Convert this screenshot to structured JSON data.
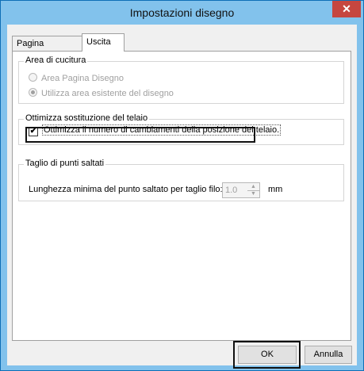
{
  "window": {
    "title": "Impostazioni disegno",
    "close_glyph": "✕"
  },
  "tabs": [
    {
      "label": "Pagina Disegno",
      "active": false
    },
    {
      "label": "Uscita",
      "active": true
    }
  ],
  "sewing_area": {
    "label": "Area di cucitura",
    "options": [
      {
        "label": "Area Pagina Disegno",
        "selected": false,
        "enabled": false
      },
      {
        "label": "Utilizza area esistente del disegno",
        "selected": true,
        "enabled": false
      }
    ]
  },
  "hoop_optimize": {
    "label": "Ottimizza sostituzione del telaio",
    "checkbox_label": "Ottimizza il numero di cambiamenti della posizione del telaio.",
    "checked": true,
    "check_glyph": "✔"
  },
  "jump_trim": {
    "label": "Taglio di punti saltati",
    "field_label": "Lunghezza minima del punto saltato per taglio filo:",
    "value": "1.0",
    "unit": "mm",
    "up_glyph": "▲",
    "down_glyph": "▼"
  },
  "buttons": {
    "ok": "OK",
    "cancel": "Annulla"
  },
  "colors": {
    "titlebar": "#82c2ec",
    "close": "#c6463f",
    "window_bg": "#f0f0f0"
  }
}
